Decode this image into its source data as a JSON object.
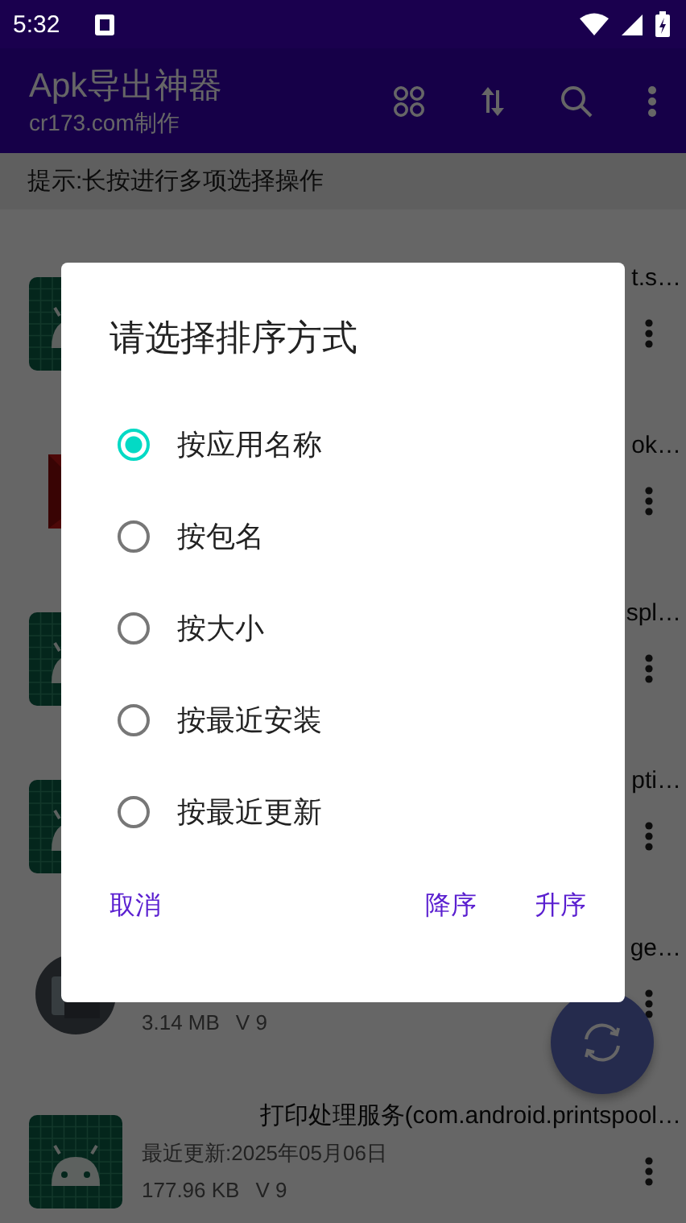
{
  "status_bar": {
    "time": "5:32"
  },
  "app_bar": {
    "title": "Apk导出神器",
    "subtitle": "cr173.com制作"
  },
  "hint": "提示:长按进行多项选择操作",
  "apps": [
    {
      "kind": "android",
      "title": "t.s…"
    },
    {
      "kind": "red",
      "title": "ok…"
    },
    {
      "kind": "android",
      "title": "spl…"
    },
    {
      "kind": "android",
      "title": "pti…"
    },
    {
      "kind": "round",
      "title": "ge…",
      "size": "3.14 MB",
      "version": "V 9"
    },
    {
      "kind": "android",
      "title": "打印处理服务(com.android.printspool…",
      "updated": "最近更新:2025年05月06日",
      "size": "177.96 KB",
      "version": "V 9"
    }
  ],
  "dialog": {
    "title": "请选择排序方式",
    "options": [
      {
        "label": "按应用名称",
        "selected": true
      },
      {
        "label": "按包名",
        "selected": false
      },
      {
        "label": "按大小",
        "selected": false
      },
      {
        "label": "按最近安装",
        "selected": false
      },
      {
        "label": "按最近更新",
        "selected": false
      }
    ],
    "buttons": [
      {
        "kind": "left",
        "label": "取消"
      },
      {
        "kind": "right",
        "label": "降序"
      },
      {
        "kind": "right",
        "label": "升序"
      }
    ]
  }
}
